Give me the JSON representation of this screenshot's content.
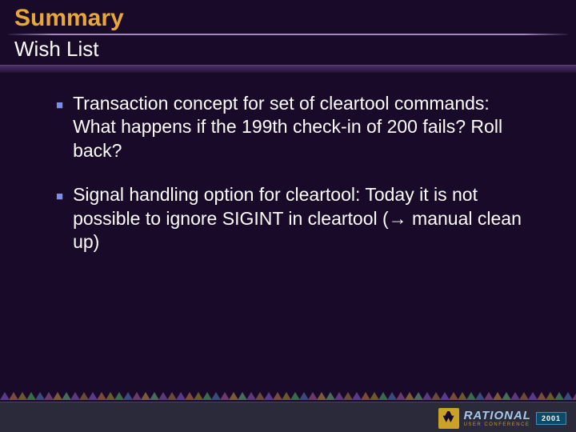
{
  "header": {
    "title": "Summary",
    "subtitle": "Wish List"
  },
  "bullets": [
    {
      "text": "Transaction concept for set of cleartool commands: What happens if the 199th check-in of 200 fails? Roll back?"
    },
    {
      "text": "Signal handling option for cleartool: Today it is not possible to ignore SIGINT in cleartool (→ manual clean up)"
    }
  ],
  "footer": {
    "brand": "RATIONAL",
    "brand_sub": "USER CONFERENCE",
    "year": "2001",
    "tri_colors": [
      "#5a3a8a",
      "#7a4a3a",
      "#6a5a2a",
      "#3a6a4a",
      "#3a4a7a",
      "#6a3a6a",
      "#7a5a3a",
      "#4a6a5a",
      "#5a3a7a",
      "#6a4a3a"
    ]
  }
}
